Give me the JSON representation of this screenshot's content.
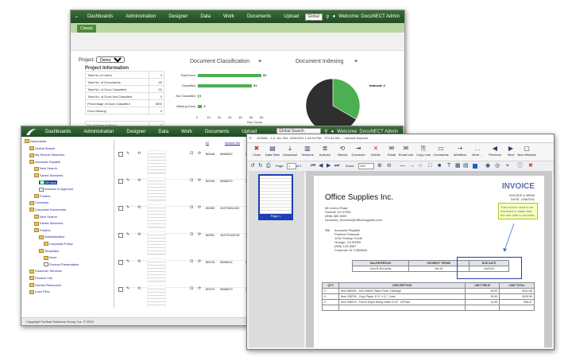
{
  "nav": {
    "items": [
      "Dashboards",
      "Administration",
      "Designer",
      "Data",
      "Work",
      "Documents",
      "Upload"
    ],
    "search_value": "Global Search",
    "welcome": "Welcome: DocuNECT Admin"
  },
  "dashboard": {
    "tab_label": "Classic",
    "project_label": "Project:",
    "project_value": "Demo",
    "info_title": "Project Information",
    "info_rows": [
      {
        "label": "Total No of Users",
        "value": "4"
      },
      {
        "label": "Total No. of Documents",
        "value": "60"
      },
      {
        "label": "Total No. of Docs Classified",
        "value": "51"
      },
      {
        "label": "Total No. of Docs Not Classified",
        "value": "0"
      },
      {
        "label": "Percentage of Docs Classified",
        "value": "85%"
      },
      {
        "label": "Docs Missing",
        "value": "4"
      }
    ],
    "users_indexed_label": "No of Users Indexed",
    "users_indexed_value": "2",
    "classification_title": "Document Classification",
    "classification": {
      "categories": [
        "Total Docs",
        "Classified",
        "Not Classified",
        "Missing Docs"
      ],
      "values": [
        60,
        51,
        0,
        4
      ],
      "ticks": [
        "0",
        "10",
        "20",
        "30",
        "40",
        "50",
        "60"
      ],
      "xlabel": "Doc Count"
    },
    "indexing_title": "Document Indexing",
    "indexing": {
      "labels": [
        "Indexed: 2",
        "Not Indexed: 4"
      ],
      "values": [
        2,
        4
      ]
    },
    "menu_icon": "hamburger-icon"
  },
  "tree": [
    "Documents",
    "Global Search",
    "My Recent Searches",
    "Accounts Payable",
    "New Search",
    "Saved Searches",
    "All docs",
    "Invoices In Approval",
    "Folders",
    "Contracts",
    "Corporate Documents",
    "New Search",
    "Saved Searches",
    "Folders",
    "Administration",
    "Corporate Policy",
    "Templates",
    "None",
    "Product Presentation",
    "Customer Services",
    "Finance Info",
    "Human Resources",
    "Loan Files"
  ],
  "grid": {
    "headers": [
      "ID",
      "Invoice No",
      "Invoice Date"
    ],
    "rows": [
      {
        "id": "80048",
        "invoice": "5656522",
        "date": "2016-10-17"
      },
      {
        "id": "80049",
        "invoice": "5656670",
        "date": "2016-10-17"
      },
      {
        "id": "80050",
        "invoice": "15273061402",
        "date": "10/18/2018"
      },
      {
        "id": "80051",
        "invoice": "15273148725",
        "date": "10/18/2018"
      },
      {
        "id": "80078",
        "invoice": "5656514",
        "date": "2016-10-17"
      },
      {
        "id": "80079",
        "invoice": "5656670",
        "date": "2016-10-17"
      }
    ],
    "footer": "Copyright Portfont Solutions Group, Inc. © 2019"
  },
  "viewer": {
    "title": "120508... 1.0, No, File, 2/25/2019 1:43:34 PM... 371.44 KB... - Internet Explorer",
    "toolbar": [
      "Close",
      "Data View",
      "Download",
      "Versions",
      "Indexes",
      "History",
      "Checkout",
      "Delete",
      "Email",
      "Email Link",
      "Copy Link",
      "Comments",
      "Workflow",
      "More ...",
      "Previous",
      "Next",
      "New Window"
    ],
    "page_label": "Page:",
    "page_value": "1",
    "page_of": "of 1",
    "zoom_label": "Zoom:",
    "zoom_value": "100",
    "thumb_label": "Page 1"
  },
  "invoice": {
    "heading": "INVOICE",
    "company": "Office Supplies Inc.",
    "number": "INVOICE # 48994",
    "date": "DATE: 12/6/2011",
    "address": [
      "58 Lemon Road",
      "Summit, NJ 07901",
      "(908) 489-5509",
      "Accounts_Services@Officesupplies.com"
    ],
    "to_label": "TO:",
    "to": [
      "Accounts Payable",
      "Portfont Financial",
      "1234 Treetop Circle",
      "Orange, CA 90009",
      "(555) 123-4567",
      "Customer ID 17856594"
    ],
    "note": "This invoice need to be reviewed to make that the due date is accurate.",
    "terms_headers": [
      "SALESPERSON",
      "PAYMENT TERMS",
      "DUE DATE"
    ],
    "terms_values": [
      "John R McCarthy",
      "Net 30",
      "1/6/2012"
    ],
    "line_headers": [
      "QTY",
      "DESCRIPTION",
      "UNIT PRICE",
      "LINE TOTAL"
    ],
    "lines": [
      {
        "qty": "2",
        "desc": "Item 868189 - Dell 2MMJF Black Toner Cartridge",
        "unit": "95.99",
        "total": "$191.98"
      },
      {
        "qty": "4",
        "desc": "Item 158794 - Copy Paper, 8 ½\" x 11\", Case",
        "unit": "39.99",
        "total": "$159.96"
      },
      {
        "qty": "3",
        "desc": "Item 358479 - Post-it Super Sticky Notes 3\"x3\", 12/Pack",
        "unit": "12.99",
        "total": "$38.97"
      }
    ]
  },
  "colors": {
    "nav_dark": "#1f4a22",
    "bar_green": "#4caf50",
    "pie_dark": "#2f2f2f",
    "accent_blue": "#1f3fb5"
  }
}
